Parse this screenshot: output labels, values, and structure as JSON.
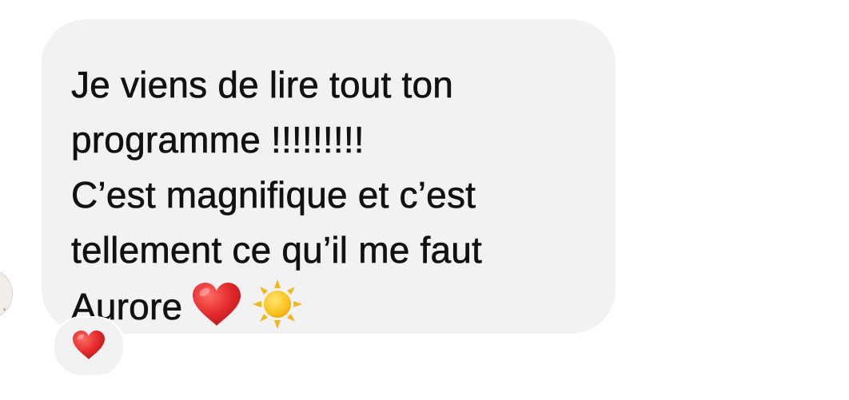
{
  "message": {
    "lines": [
      "Je viens de lire tout ton",
      "programme !!!!!!!!!",
      "C’est magnifique et c’est",
      "tellement ce qu’il me faut",
      "Aurore"
    ],
    "emojis": [
      "red-heart",
      "sun"
    ]
  },
  "reaction": {
    "emoji": "red-heart"
  },
  "colors": {
    "bubble": "#f2f2f5",
    "text": "#111111",
    "heart": "#e32b2b",
    "sun": "#f9c31c"
  }
}
